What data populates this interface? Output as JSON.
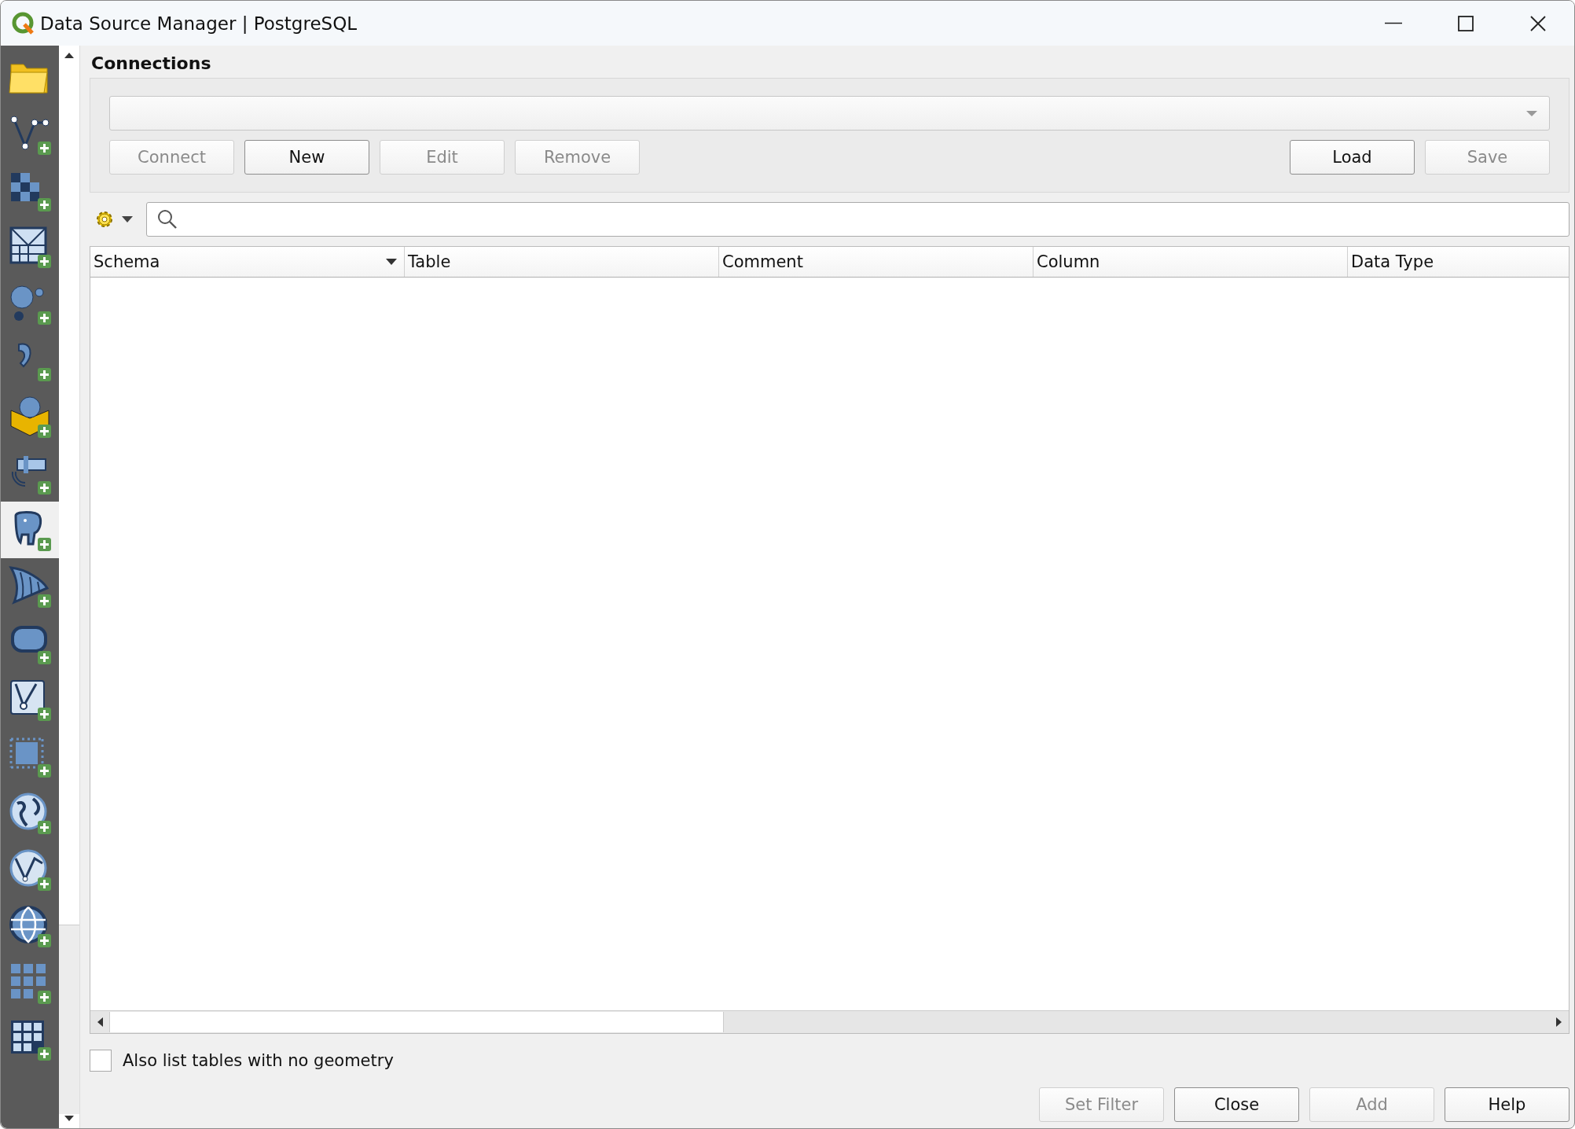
{
  "window": {
    "title": "Data Source Manager | PostgreSQL"
  },
  "sidebar": {
    "items": [
      {
        "kind": "browser",
        "selected": false
      },
      {
        "kind": "vector",
        "selected": false
      },
      {
        "kind": "raster",
        "selected": false
      },
      {
        "kind": "mesh",
        "selected": false
      },
      {
        "kind": "delimited",
        "selected": false
      },
      {
        "kind": "geopackage",
        "selected": false
      },
      {
        "kind": "gps",
        "selected": false
      },
      {
        "kind": "spatialite",
        "selected": false
      },
      {
        "kind": "postgresql",
        "selected": true
      },
      {
        "kind": "mssql",
        "selected": false
      },
      {
        "kind": "oracle",
        "selected": false
      },
      {
        "kind": "virtual",
        "selected": false
      },
      {
        "kind": "pointcloud",
        "selected": false
      },
      {
        "kind": "wms",
        "selected": false
      },
      {
        "kind": "wfs",
        "selected": false
      },
      {
        "kind": "wcs",
        "selected": false
      },
      {
        "kind": "xyz",
        "selected": false
      },
      {
        "kind": "arcgis",
        "selected": false
      }
    ]
  },
  "connections": {
    "title": "Connections",
    "buttons": [
      {
        "label": "Connect",
        "disabled": true
      },
      {
        "label": "New",
        "disabled": false
      },
      {
        "label": "Edit",
        "disabled": true
      },
      {
        "label": "Remove",
        "disabled": true
      }
    ],
    "file_buttons": [
      {
        "label": "Load",
        "disabled": false
      },
      {
        "label": "Save",
        "disabled": true
      }
    ]
  },
  "table": {
    "columns": [
      {
        "label": "Schema",
        "sorted": true
      },
      {
        "label": "Table",
        "sorted": false
      },
      {
        "label": "Comment",
        "sorted": false
      },
      {
        "label": "Column",
        "sorted": false
      },
      {
        "label": "Data Type",
        "sorted": false
      }
    ]
  },
  "option": {
    "label": "Also list tables with no geometry",
    "checked": false
  },
  "buttons": [
    {
      "label": "Set Filter",
      "disabled": true
    },
    {
      "label": "Close",
      "disabled": false
    },
    {
      "label": "Add",
      "disabled": true
    },
    {
      "label": "Help",
      "disabled": false
    }
  ]
}
